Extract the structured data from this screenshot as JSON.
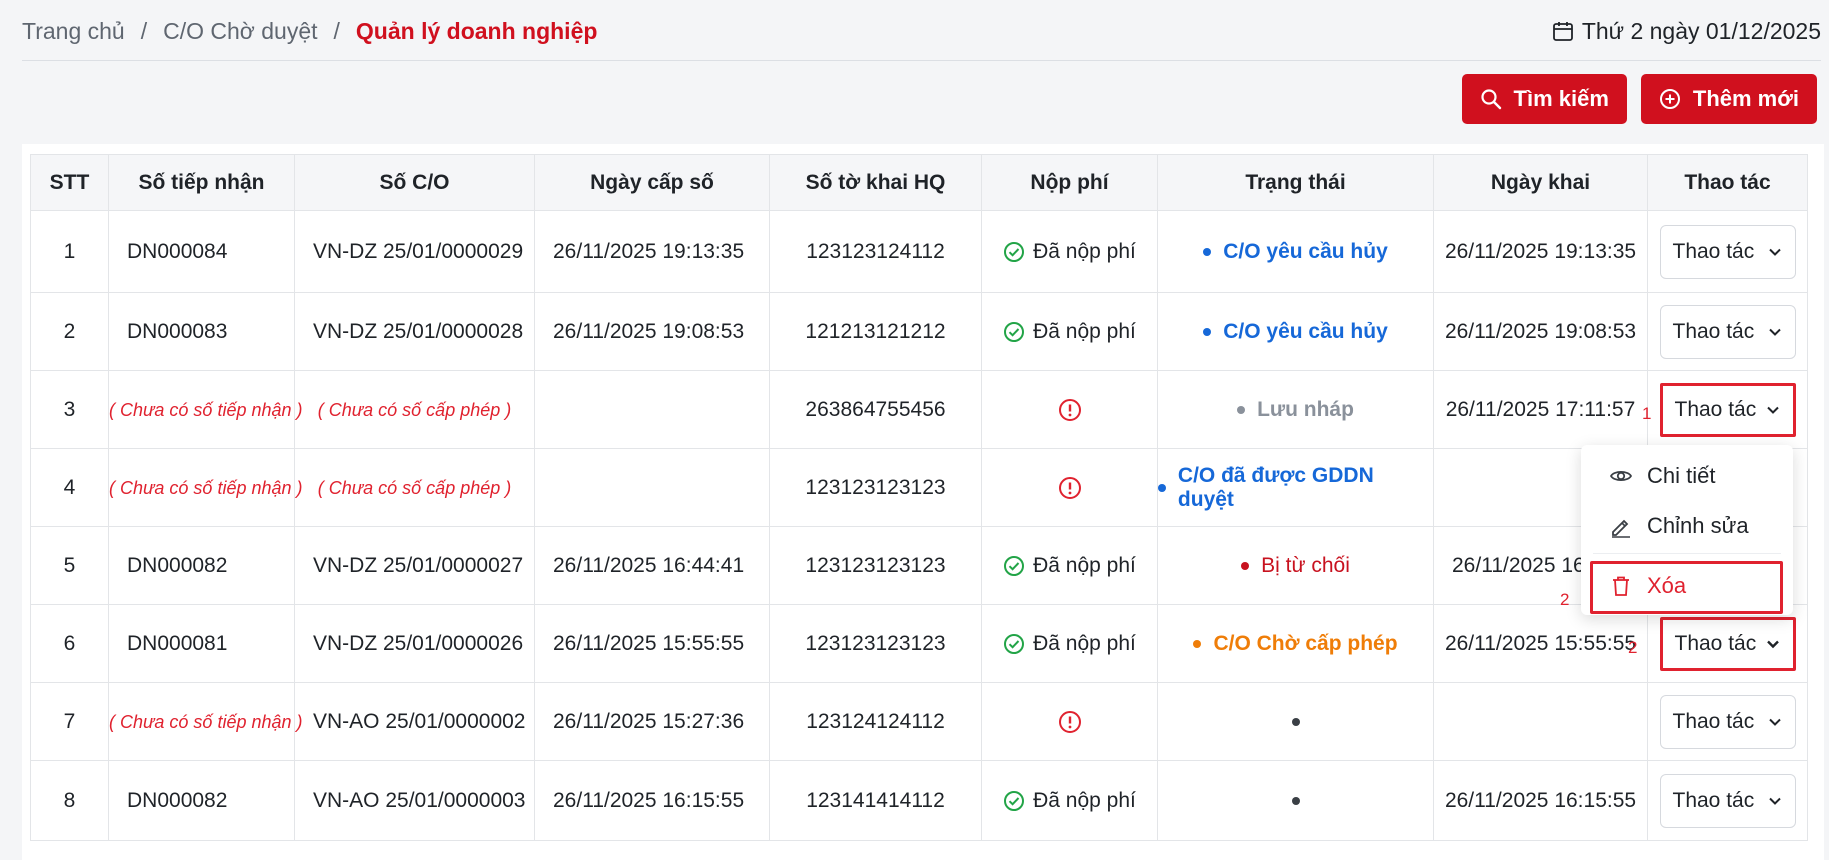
{
  "breadcrumb": {
    "home": "Trang chủ",
    "section": "C/O Chờ duyệt",
    "current": "Quản lý doanh nghiệp",
    "separator": "/"
  },
  "header": {
    "date": "Thứ 2 ngày 01/12/2025"
  },
  "toolbar": {
    "search_label": "Tìm kiếm",
    "add_label": "Thêm mới"
  },
  "table": {
    "columns": [
      "STT",
      "Số tiếp nhận",
      "Số C/O",
      "Ngày cấp số",
      "Số tờ khai HQ",
      "Nộp phí",
      "Trạng thái",
      "Ngày khai",
      "Thao tác"
    ],
    "rows": [
      {
        "stt": "1",
        "receipt": "DN000084",
        "co": "VN-DZ 25/01/0000029",
        "issued": "26/11/2025 19:13:35",
        "customs": "123123124112",
        "fee": "Đã nộp phí",
        "status": "C/O yêu cầu hủy",
        "declared": "26/11/2025 19:13:35",
        "action": "Thao tác"
      },
      {
        "stt": "2",
        "receipt": "DN000083",
        "co": "VN-DZ 25/01/0000028",
        "issued": "26/11/2025 19:08:53",
        "customs": "121213121212",
        "fee": "Đã nộp phí",
        "status": "C/O yêu cầu hủy",
        "declared": "26/11/2025 19:08:53",
        "action": "Thao tác"
      },
      {
        "stt": "3",
        "receipt": "( Chưa có số tiếp nhận )",
        "co": "( Chưa có số cấp phép )",
        "issued": "",
        "customs": "263864755456",
        "fee": "",
        "status": "Lưu nháp",
        "declared": "26/11/2025 17:11:57",
        "action": "Thao tác"
      },
      {
        "stt": "4",
        "receipt": "( Chưa có số tiếp nhận )",
        "co": "( Chưa có số cấp phép )",
        "issued": "",
        "customs": "123123123123",
        "fee": "",
        "status": "C/O đã được GDDN duyệt",
        "declared": "",
        "action": ""
      },
      {
        "stt": "5",
        "receipt": "DN000082",
        "co": "VN-DZ 25/01/0000027",
        "issued": "26/11/2025 16:44:41",
        "customs": "123123123123",
        "fee": "Đã nộp phí",
        "status": "Bị từ chối",
        "declared": "26/11/2025 16:",
        "action": ""
      },
      {
        "stt": "6",
        "receipt": "DN000081",
        "co": "VN-DZ 25/01/0000026",
        "issued": "26/11/2025 15:55:55",
        "customs": "123123123123",
        "fee": "Đã nộp phí",
        "status": "C/O Chờ cấp phép",
        "declared": "26/11/2025 15:55:55",
        "action": "Thao tác"
      },
      {
        "stt": "7",
        "receipt": "( Chưa có số tiếp nhận )",
        "co": "VN-AO 25/01/0000002",
        "issued": "26/11/2025 15:27:36",
        "customs": "123124124112",
        "fee": "",
        "status": "",
        "declared": "",
        "action": "Thao tác"
      },
      {
        "stt": "8",
        "receipt": "DN000082",
        "co": "VN-AO 25/01/0000003",
        "issued": "26/11/2025 16:15:55",
        "customs": "123141414112",
        "fee": "Đã nộp phí",
        "status": "",
        "declared": "26/11/2025 16:15:55",
        "action": "Thao tác"
      }
    ]
  },
  "dropdown": {
    "detail": "Chi tiết",
    "edit": "Chỉnh sửa",
    "delete": "Xóa"
  },
  "markers": {
    "m1": "1",
    "m2a": "2",
    "m2b": "2"
  },
  "colors": {
    "accent": "#d0101e",
    "blue": "#1668d8",
    "orange": "#ef7d08",
    "green": "#22a447"
  }
}
